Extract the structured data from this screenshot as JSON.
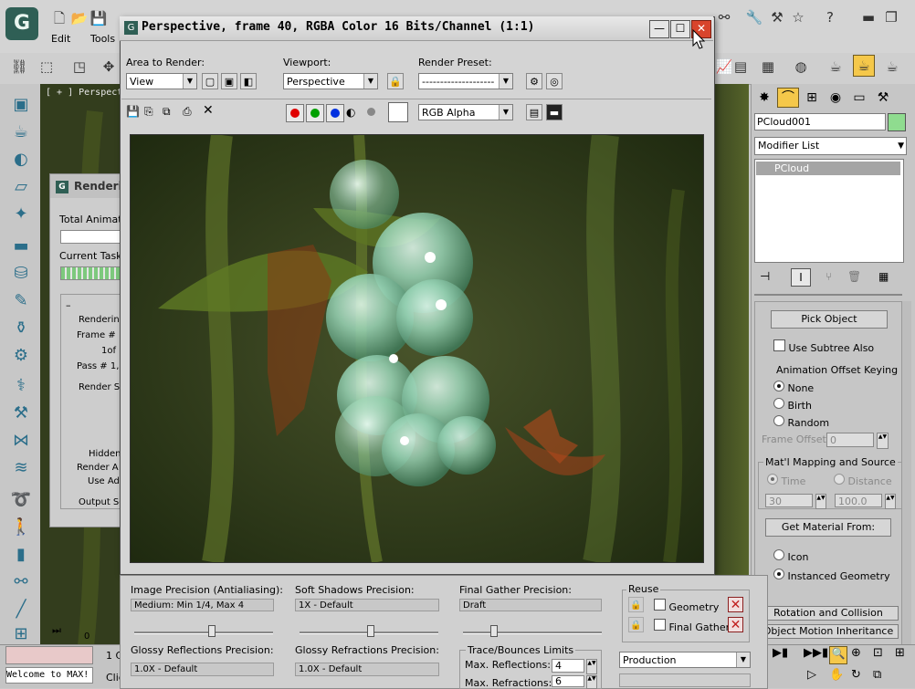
{
  "app": {
    "menu": [
      "Edit",
      "Tools"
    ],
    "viewport_label": "[ + ] Perspect",
    "welcome_text": "Welcome to MAX!",
    "status_frag1": "1 C",
    "status_frag2": "Clic",
    "timeline_tick": "0"
  },
  "progress_dialog": {
    "title": "Renderi",
    "total_animation": "Total Animatio",
    "current_task": "Current Task:",
    "group_rendering": "Renderin",
    "frame_label": "Frame #",
    "of_label": "1of",
    "pass_label": "Pass #  1,",
    "render_settings": "Render S",
    "hidden": "Hidden",
    "render_a": "Render A",
    "use_ad": "Use Ad",
    "output": "Output Se",
    "minus": "–"
  },
  "frame_window": {
    "title": "Perspective, frame 40, RGBA Color 16 Bits/Channel (1:1)",
    "area_to_render": {
      "label": "Area to Render:",
      "value": "View"
    },
    "viewport": {
      "label": "Viewport:",
      "value": "Perspective"
    },
    "render_preset": {
      "label": "Render Preset:",
      "value": "--------------------"
    },
    "channel": "RGB Alpha",
    "buttons": {
      "min": "—",
      "max": "☐",
      "close": "✕"
    }
  },
  "command_panel": {
    "object_name": "PCloud001",
    "object_color": "#8fdc8f",
    "modifier_list": "Modifier List",
    "stack_item": "PCloud",
    "pick_object": "Pick Object",
    "use_subtree": "Use Subtree Also",
    "anim_offset_label": "Animation Offset Keying",
    "offset_options": [
      {
        "label": "None",
        "selected": true
      },
      {
        "label": "Birth",
        "selected": false
      },
      {
        "label": "Random",
        "selected": false
      }
    ],
    "frame_offset_label": "Frame Offset:",
    "frame_offset_value": "0",
    "matl_group": "Mat'l Mapping and Source",
    "time_label": "Time",
    "distance_label": "Distance",
    "time_value": "30",
    "distance_value": "100.0",
    "get_material": "Get Material From:",
    "icon_label": "Icon",
    "instanced_label": "Instanced Geometry",
    "rollouts": [
      "Rotation and Collision",
      "Object Motion Inheritance"
    ]
  },
  "render_settings": {
    "image_precision": {
      "label": "Image Precision (Antialiasing):",
      "value": "Medium: Min 1/4, Max 4",
      "level": 0.55
    },
    "soft_shadows": {
      "label": "Soft Shadows Precision:",
      "value": "1X - Default",
      "level": 0.5
    },
    "final_gather": {
      "label": "Final Gather Precision:",
      "value": "Draft",
      "level": 0.2
    },
    "glossy_reflections": {
      "label": "Glossy Reflections Precision:",
      "value": "1.0X - Default"
    },
    "glossy_refractions": {
      "label": "Glossy Refractions Precision:",
      "value": "1.0X - Default"
    },
    "reuse_label": "Reuse",
    "geometry_label": "Geometry",
    "final_gather_label": "Final Gather",
    "trace_label": "Trace/Bounces Limits",
    "max_reflections_label": "Max. Reflections:",
    "max_reflections_value": "4",
    "max_refractions_label": "Max. Refractions:",
    "max_refractions_value": "6",
    "preset": "Production"
  }
}
